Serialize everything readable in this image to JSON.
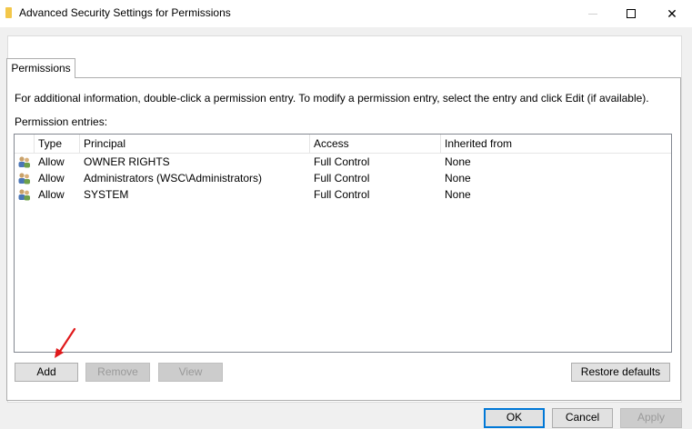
{
  "window": {
    "title": "Advanced Security Settings for Permissions",
    "close_glyph": "✕"
  },
  "tabs": [
    {
      "label": "Permissions",
      "selected": true
    }
  ],
  "permissions": {
    "info_text": "For additional information, double-click a permission entry. To modify a permission entry, select the entry and click Edit (if available).",
    "entries_label": "Permission entries:",
    "columns": [
      "Type",
      "Principal",
      "Access",
      "Inherited from"
    ],
    "rows": [
      {
        "icon": "users-icon",
        "type": "Allow",
        "principal": "OWNER RIGHTS",
        "access": "Full Control",
        "inherited": "None"
      },
      {
        "icon": "users-icon",
        "type": "Allow",
        "principal": "Administrators (WSC\\Administrators)",
        "access": "Full Control",
        "inherited": "None"
      },
      {
        "icon": "users-icon",
        "type": "Allow",
        "principal": "SYSTEM",
        "access": "Full Control",
        "inherited": "None"
      }
    ],
    "buttons": {
      "add": "Add",
      "remove": "Remove",
      "view": "View",
      "restore_defaults": "Restore defaults"
    }
  },
  "footer": {
    "ok": "OK",
    "cancel": "Cancel",
    "apply": "Apply"
  },
  "colors": {
    "annotation_arrow": "#e0191b",
    "accent": "#0078d7"
  }
}
